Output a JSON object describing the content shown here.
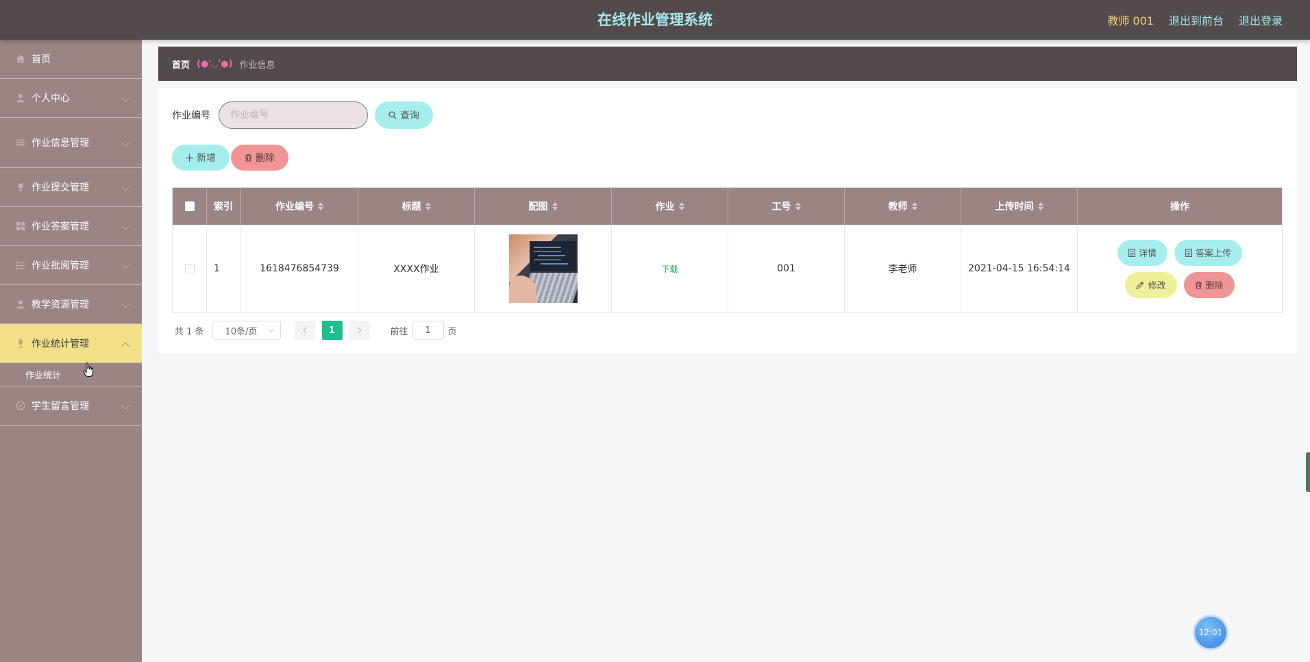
{
  "header": {
    "title": "在线作业管理系统",
    "user": "教师 001",
    "to_front": "退出到前台",
    "logout": "退出登录"
  },
  "sidebar": {
    "items": [
      {
        "label": "首页",
        "icon": "home-icon"
      },
      {
        "label": "个人中心",
        "icon": "user-icon"
      },
      {
        "label": "作业信息管理",
        "icon": "list-icon"
      },
      {
        "label": "作业提交管理",
        "icon": "trophy-icon"
      },
      {
        "label": "作业答案管理",
        "icon": "grid-icon"
      },
      {
        "label": "作业批阅管理",
        "icon": "menu-icon"
      },
      {
        "label": "教学资源管理",
        "icon": "user-icon"
      },
      {
        "label": "作业统计管理",
        "icon": "mic-icon",
        "active": true
      },
      {
        "label": "学生留言管理",
        "icon": "compass-icon"
      }
    ],
    "submenu": [
      "作业统计"
    ]
  },
  "breadcrumb": {
    "home": "首页",
    "separator": "(●'◡'●)",
    "current": "作业信息"
  },
  "search": {
    "label": "作业编号",
    "placeholder": "作业编号",
    "button": "查询"
  },
  "actions": {
    "add": "新增",
    "delete": "删除"
  },
  "table": {
    "headers": {
      "index": "索引",
      "code": "作业编号",
      "title": "标题",
      "image": "配图",
      "file": "作业",
      "staff_no": "工号",
      "teacher": "教师",
      "upload_time": "上传时间",
      "ops": "操作"
    },
    "rows": [
      {
        "index": "1",
        "code": "1618476854739",
        "title": "XXXX作业",
        "file": "下载",
        "staff_no": "001",
        "teacher": "李老师",
        "upload_time": "2021-04-15 16:54:14",
        "ops": {
          "detail": "详情",
          "upload_answer": "答案上传",
          "edit": "修改",
          "delete": "删除"
        }
      }
    ]
  },
  "pagination": {
    "total": "共 1 条",
    "page_size": "10条/页",
    "current_page": "1",
    "goto_prefix": "前往",
    "goto_value": "1",
    "goto_suffix": "页"
  },
  "clock": "12:01",
  "colors": {
    "header_bg": "#524a4b",
    "sidebar_bg": "#9b8584",
    "active_menu": "#f2e089",
    "title_color": "#a6e8ea",
    "cyan_button": "#a6eeee",
    "red_button": "#ef9595",
    "yellow_button": "#eff09a",
    "page_active": "#1bbf8e"
  }
}
